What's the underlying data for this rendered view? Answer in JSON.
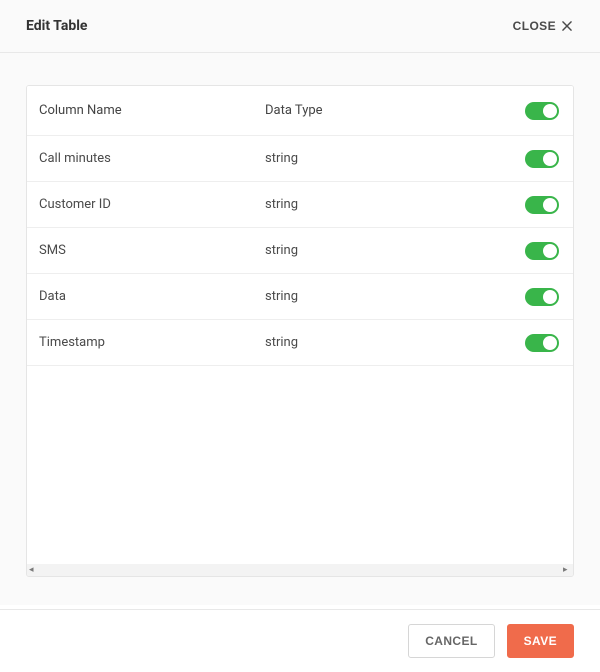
{
  "header": {
    "title": "Edit Table",
    "close_label": "CLOSE"
  },
  "table": {
    "headers": {
      "col_name": "Column Name",
      "data_type": "Data Type"
    },
    "rows": [
      {
        "name": "Call minutes",
        "type": "string",
        "enabled": true
      },
      {
        "name": "Customer ID",
        "type": "string",
        "enabled": true
      },
      {
        "name": "SMS",
        "type": "string",
        "enabled": true
      },
      {
        "name": "Data",
        "type": "string",
        "enabled": true
      },
      {
        "name": "Timestamp",
        "type": "string",
        "enabled": true
      }
    ]
  },
  "footer": {
    "cancel_label": "CANCEL",
    "save_label": "SAVE"
  },
  "colors": {
    "toggle_on": "#39b54a",
    "save_button": "#f06b4b"
  }
}
